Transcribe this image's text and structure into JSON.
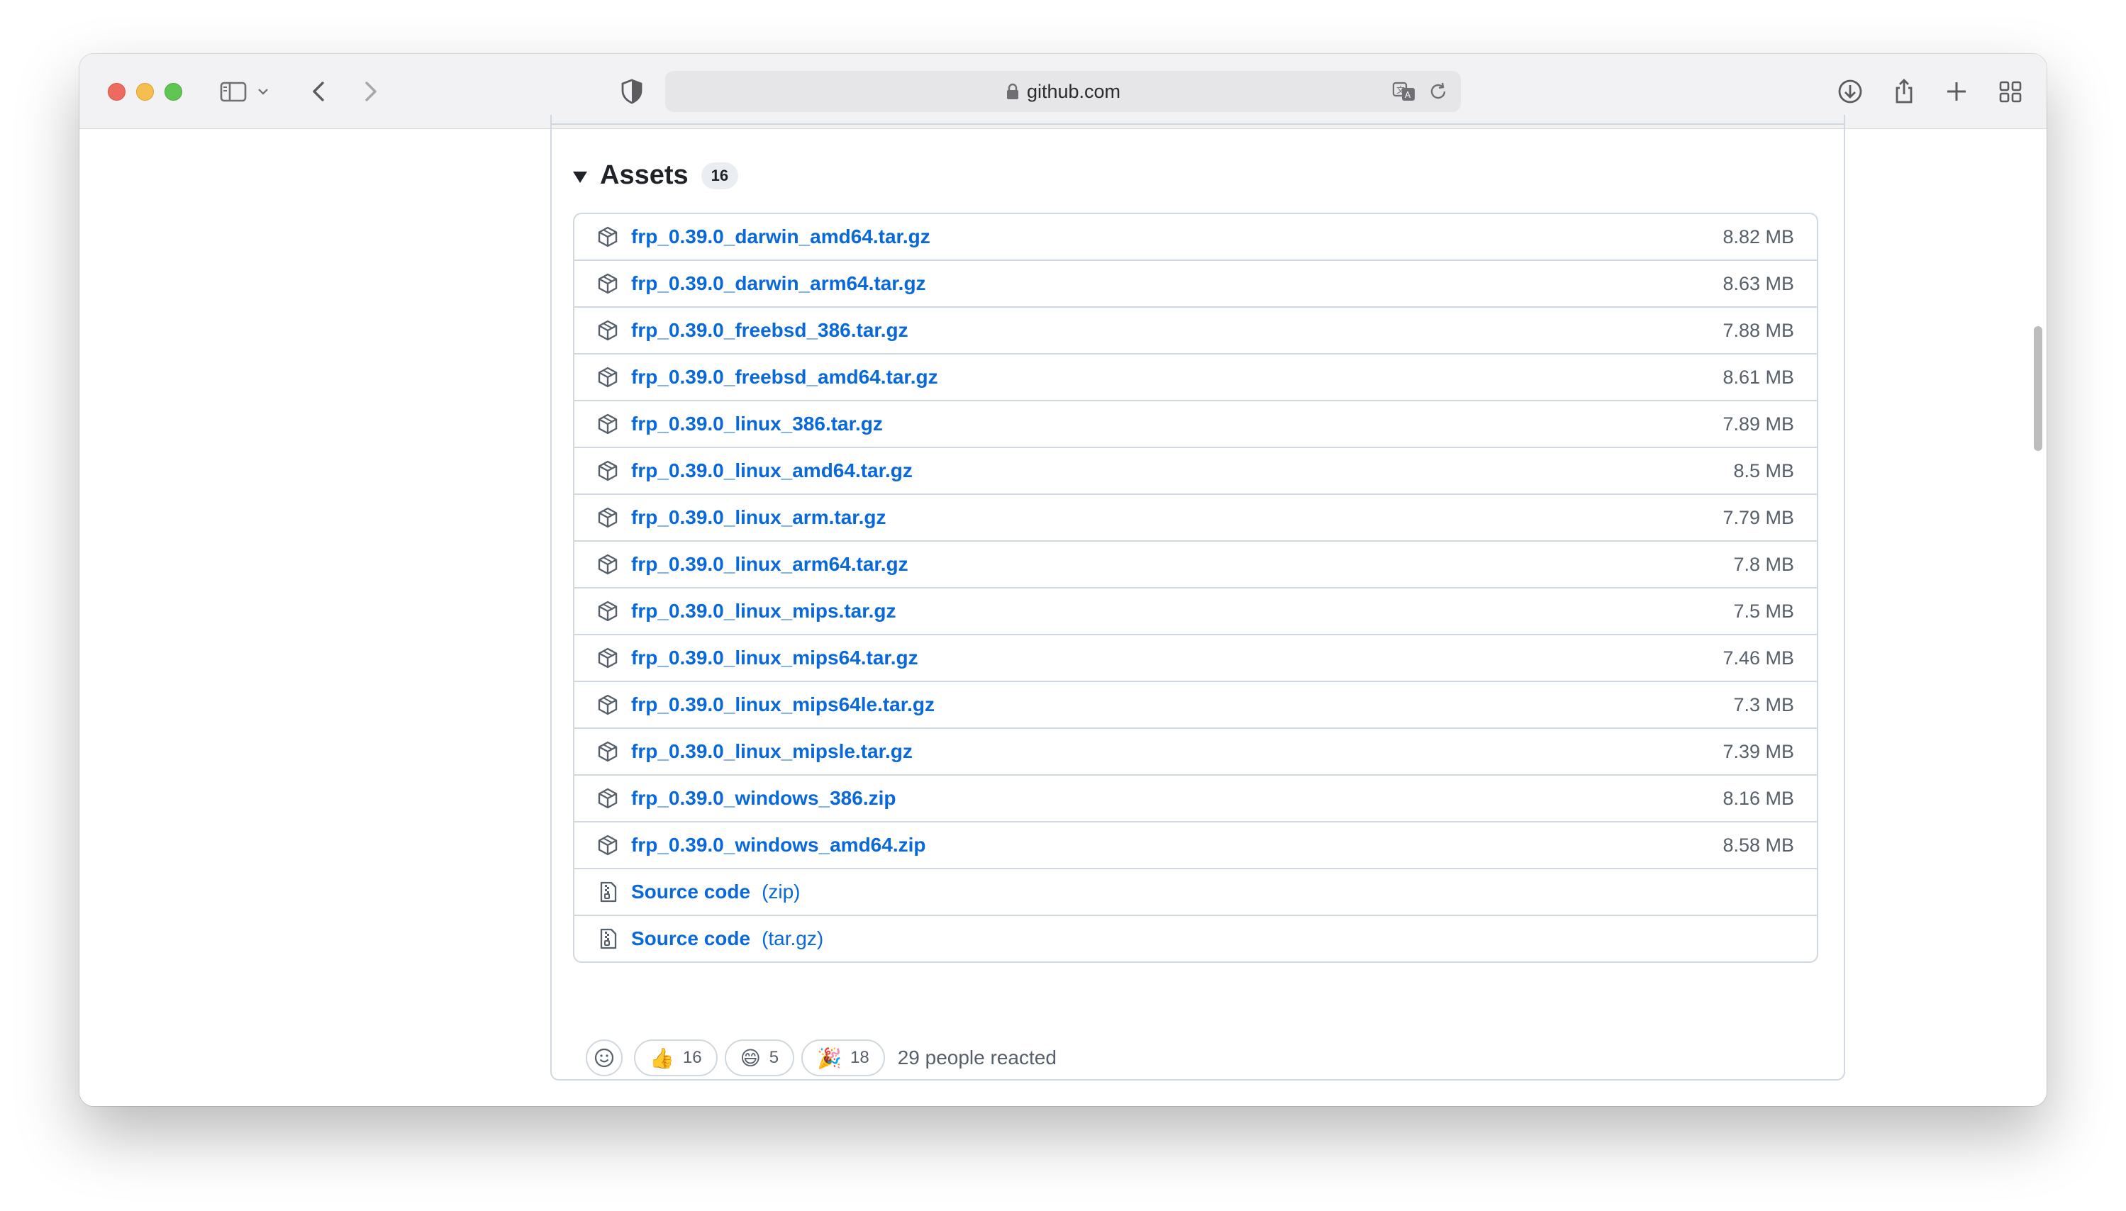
{
  "browser": {
    "url": "github.com"
  },
  "assets": {
    "title": "Assets",
    "count": "16",
    "items": [
      {
        "name": "frp_0.39.0_darwin_amd64.tar.gz",
        "size": "8.82 MB"
      },
      {
        "name": "frp_0.39.0_darwin_arm64.tar.gz",
        "size": "8.63 MB"
      },
      {
        "name": "frp_0.39.0_freebsd_386.tar.gz",
        "size": "7.88 MB"
      },
      {
        "name": "frp_0.39.0_freebsd_amd64.tar.gz",
        "size": "8.61 MB"
      },
      {
        "name": "frp_0.39.0_linux_386.tar.gz",
        "size": "7.89 MB"
      },
      {
        "name": "frp_0.39.0_linux_amd64.tar.gz",
        "size": "8.5 MB"
      },
      {
        "name": "frp_0.39.0_linux_arm.tar.gz",
        "size": "7.79 MB"
      },
      {
        "name": "frp_0.39.0_linux_arm64.tar.gz",
        "size": "7.8 MB"
      },
      {
        "name": "frp_0.39.0_linux_mips.tar.gz",
        "size": "7.5 MB"
      },
      {
        "name": "frp_0.39.0_linux_mips64.tar.gz",
        "size": "7.46 MB"
      },
      {
        "name": "frp_0.39.0_linux_mips64le.tar.gz",
        "size": "7.3 MB"
      },
      {
        "name": "frp_0.39.0_linux_mipsle.tar.gz",
        "size": "7.39 MB"
      },
      {
        "name": "frp_0.39.0_windows_386.zip",
        "size": "8.16 MB"
      },
      {
        "name": "frp_0.39.0_windows_amd64.zip",
        "size": "8.58 MB"
      }
    ],
    "source": [
      {
        "name": "Source code",
        "suffix": "(zip)"
      },
      {
        "name": "Source code",
        "suffix": "(tar.gz)"
      }
    ]
  },
  "reactions": {
    "items": [
      {
        "emoji": "👍",
        "count": "16"
      },
      {
        "emoji": "😄",
        "count": "5"
      },
      {
        "emoji": "🎉",
        "count": "18"
      }
    ],
    "summary": "29 people reacted"
  }
}
